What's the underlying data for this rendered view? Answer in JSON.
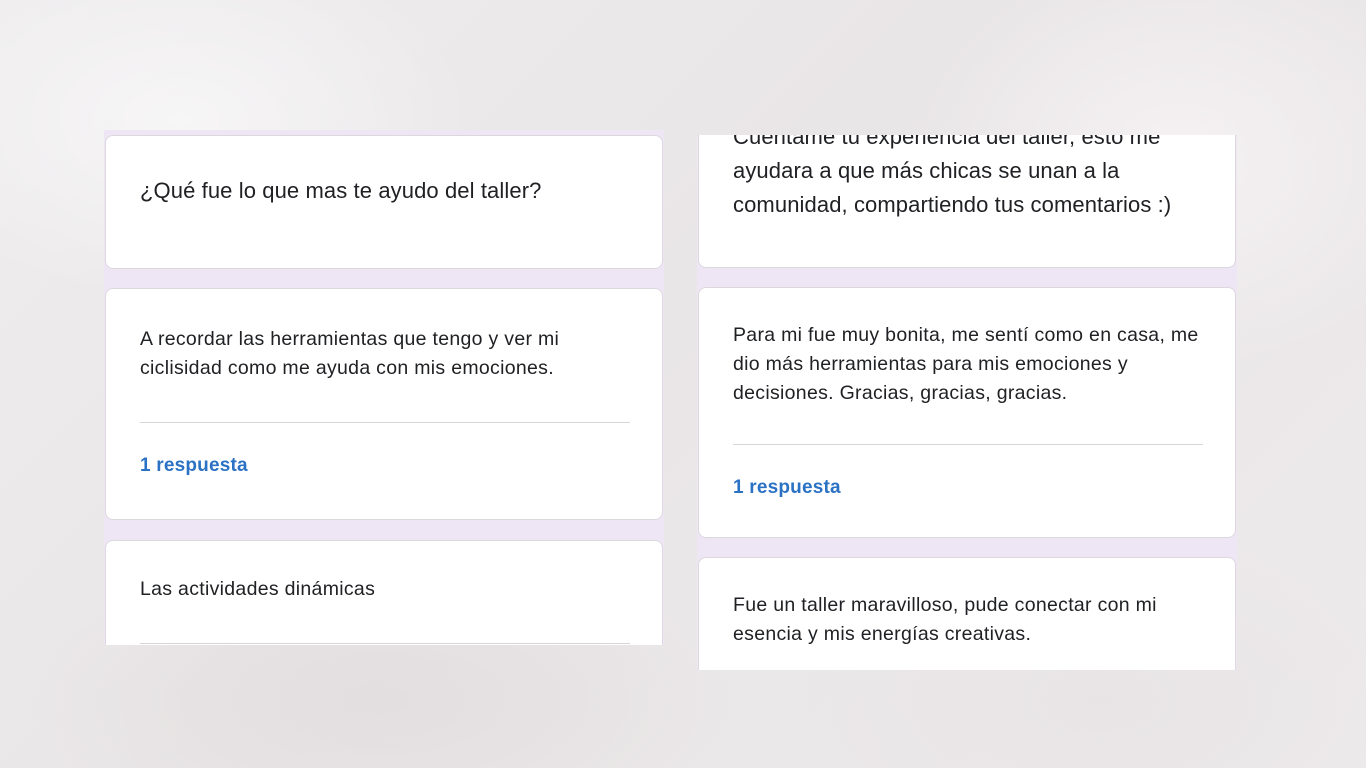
{
  "left_column": {
    "question": "¿Qué fue lo que mas te ayudo del taller?",
    "responses": [
      {
        "text": "A recordar las herramientas que tengo y ver mi ciclisidad como me ayuda con mis emociones.",
        "count_label": "1 respuesta"
      },
      {
        "text": "Las actividades dinámicas"
      }
    ]
  },
  "right_column": {
    "question": "Cuéntame tu experiencia del taller, esto me ayudara a que más chicas se unan a la comunidad, compartiendo tus comentarios :)",
    "responses": [
      {
        "text": "Para mi fue muy bonita, me sentí como en casa, me dio más herramientas para mis emociones y decisiones. Gracias, gracias, gracias.",
        "count_label": "1 respuesta"
      },
      {
        "text": "Fue un taller maravilloso, pude conectar con mi esencia y mis energías creativas."
      }
    ]
  },
  "colors": {
    "accent_link": "#2b72c4",
    "card_bg": "#ffffff",
    "column_tint": "#efe6f5",
    "text": "#202124"
  }
}
